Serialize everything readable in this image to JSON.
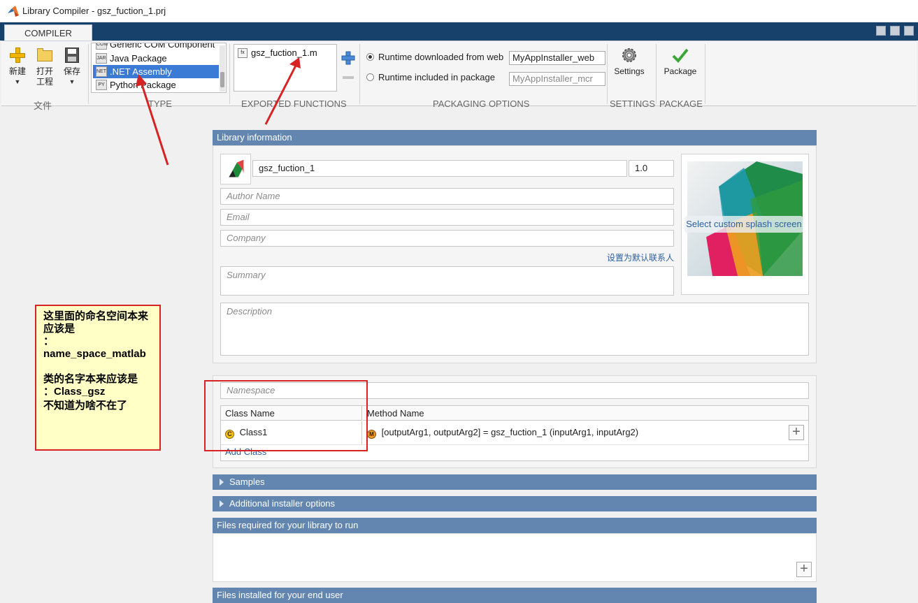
{
  "window": {
    "title": "Library Compiler - gsz_fuction_1.prj"
  },
  "ribbon": {
    "tab_label": "COMPILER",
    "file_section": {
      "label": "文件",
      "new_label": "新建",
      "open_label_line1": "打开",
      "open_label_line2": "工程",
      "save_label": "保存"
    },
    "type_section": {
      "label": "TYPE",
      "items": [
        {
          "label": "Generic COM Component",
          "icon_text": "COM"
        },
        {
          "label": "Java Package",
          "icon_text": "JAR"
        },
        {
          "label": ".NET Assembly",
          "icon_text": "NET"
        },
        {
          "label": "Python Package",
          "icon_text": "PY"
        }
      ],
      "selected": ".NET Assembly"
    },
    "exported_functions": {
      "label": "EXPORTED FUNCTIONS",
      "items": [
        "gsz_fuction_1.m"
      ],
      "icon_text": "fx"
    },
    "packaging_options": {
      "label": "PACKAGING OPTIONS",
      "web_label": "Runtime downloaded from web",
      "web_value": "MyAppInstaller_web",
      "included_label": "Runtime included in package",
      "included_value": "MyAppInstaller_mcr",
      "selected": "web"
    },
    "settings": {
      "button_label": "Settings",
      "label": "SETTINGS"
    },
    "package": {
      "button_label": "Package",
      "label": "PACKAGE"
    }
  },
  "library_info": {
    "header": "Library information",
    "name": "gsz_fuction_1",
    "version": "1.0",
    "author_placeholder": "Author Name",
    "email_placeholder": "Email",
    "company_placeholder": "Company",
    "default_contact_link": "设置为默认联系人",
    "summary_placeholder": "Summary",
    "description_placeholder": "Description",
    "splash_button": "Select custom splash screen"
  },
  "classes": {
    "namespace_placeholder": "Namespace",
    "class_name_header": "Class Name",
    "method_name_header": "Method Name",
    "rows": [
      {
        "class_name": "Class1",
        "class_badge": "C",
        "method": "[outputArg1, outputArg2] = gsz_fuction_1 (inputArg1, inputArg2)",
        "method_badge": "M"
      }
    ],
    "add_class_label": "Add Class"
  },
  "sections": {
    "samples": "Samples",
    "additional_installer": "Additional installer options",
    "files_required": "Files required for your library to run",
    "files_installed": "Files installed for your end user"
  },
  "annotation": {
    "line1": "这里面的命名空间本来应该是",
    "line2": "：name_space_matlab",
    "line3": "类的名字本来应该是",
    "line4": "：Class_gsz",
    "line5": "不知道为啥不在了"
  },
  "colors": {
    "ribbon_tab_strip": "#17416a",
    "panel_header": "#6286b0",
    "selection": "#3b7bd6",
    "annotation_red": "#d62323",
    "annotation_bg": "#ffffc6"
  }
}
